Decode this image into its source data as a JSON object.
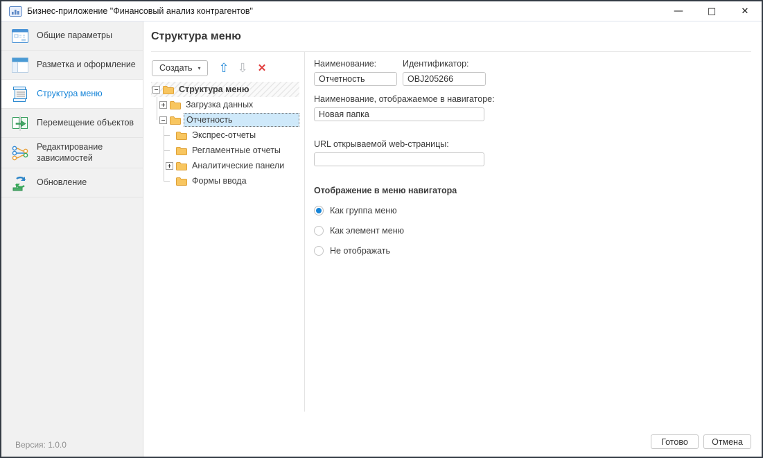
{
  "window": {
    "title": "Бизнес-приложение \"Финансовый анализ контрагентов\"",
    "controls": {
      "minimize": "—",
      "maximize": "□",
      "close": "✕"
    }
  },
  "sidebar": {
    "items": [
      {
        "label": "Общие параметры",
        "icon": "general-params-icon",
        "selected": false
      },
      {
        "label": "Разметка и оформление",
        "icon": "layout-icon",
        "selected": false
      },
      {
        "label": "Структура меню",
        "icon": "menu-structure-icon",
        "selected": true
      },
      {
        "label": "Перемещение объектов",
        "icon": "move-objects-icon",
        "selected": false
      },
      {
        "label": "Редактирование зависимостей",
        "icon": "dependencies-icon",
        "selected": false
      },
      {
        "label": "Обновление",
        "icon": "refresh-icon",
        "selected": false
      }
    ],
    "version": "Версия: 1.0.0"
  },
  "main": {
    "title": "Структура меню",
    "toolbar": {
      "create_label": "Создать",
      "icons": {
        "caret": "▾",
        "move_up": "⇧",
        "move_down": "⇩",
        "delete": "✕"
      }
    },
    "tree": {
      "nodes": [
        {
          "label": "Структура меню",
          "level": 0,
          "expander": "minus",
          "bold": true,
          "hatched": true,
          "selected": false
        },
        {
          "label": "Загрузка данных",
          "level": 1,
          "expander": "plus",
          "selected": false
        },
        {
          "label": "Отчетность",
          "level": 1,
          "expander": "minus",
          "selected": true
        },
        {
          "label": "Экспрес-отчеты",
          "level": 2,
          "expander": "none",
          "selected": false
        },
        {
          "label": "Регламентные отчеты",
          "level": 2,
          "expander": "none",
          "selected": false
        },
        {
          "label": "Аналитические панели",
          "level": 2,
          "expander": "plus",
          "selected": false
        },
        {
          "label": "Формы ввода",
          "level": 2,
          "expander": "none",
          "selected": false
        }
      ]
    },
    "form": {
      "name_label": "Наименование:",
      "name_value": "Отчетность",
      "id_label": "Идентификатор:",
      "id_value": "OBJ205266",
      "nav_name_label": "Наименование, отображаемое в навигаторе:",
      "nav_name_value": "Новая папка",
      "url_label": "URL открываемой web-страницы:",
      "url_value": "",
      "display_group_label": "Отображение в меню навигатора",
      "radios": [
        {
          "label": "Как группа меню",
          "selected": true
        },
        {
          "label": "Как элемент меню",
          "selected": false
        },
        {
          "label": "Не отображать",
          "selected": false
        }
      ]
    }
  },
  "footer": {
    "done_label": "Готово",
    "cancel_label": "Отмена"
  },
  "colors": {
    "accent": "#1584d8",
    "tree_selection_bg": "#cfe9fa",
    "danger": "#e03a3a",
    "folder_fill": "#f8c660",
    "folder_stroke": "#dfa23a",
    "sidebar_bg": "#f1f1f1"
  }
}
